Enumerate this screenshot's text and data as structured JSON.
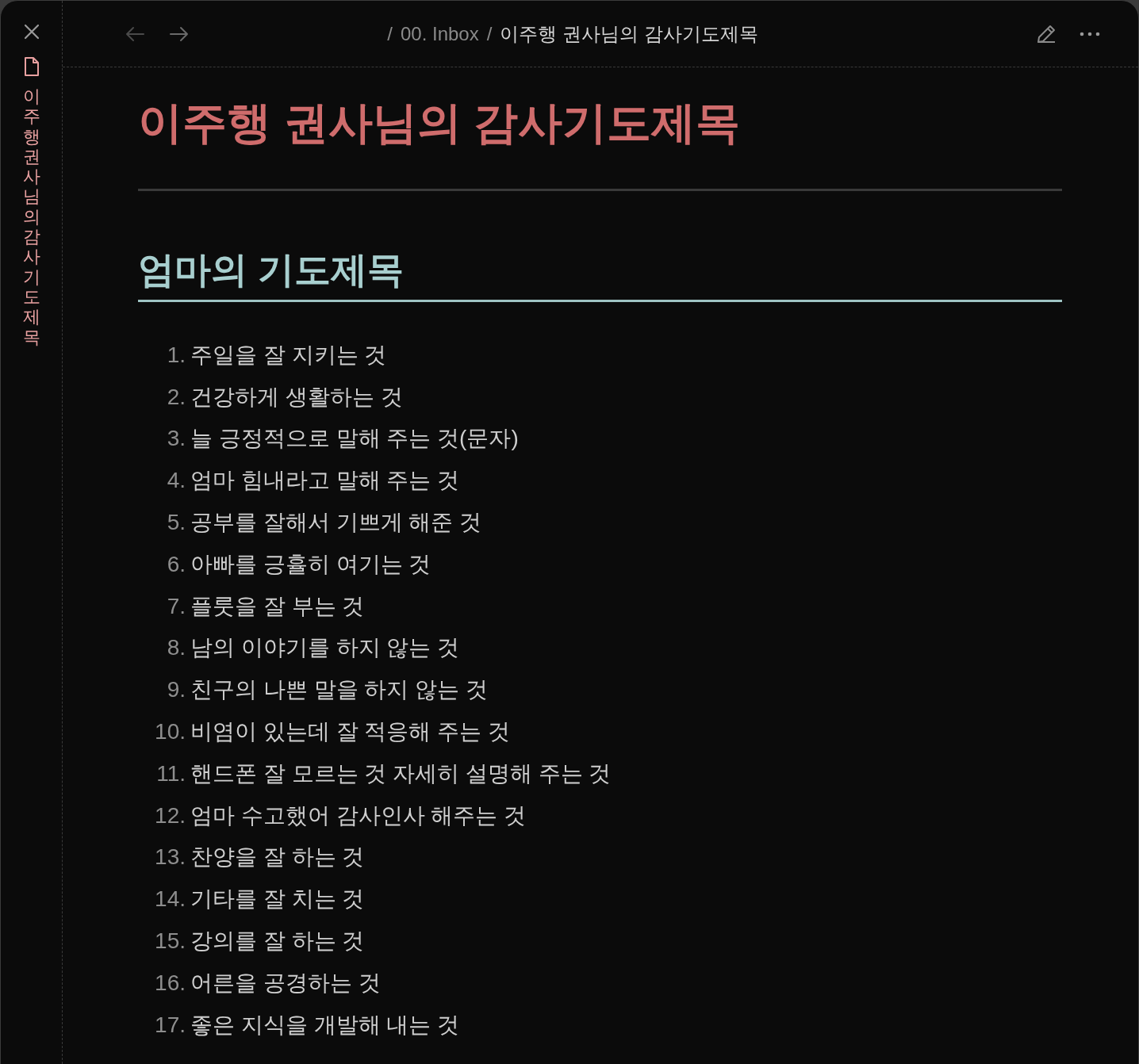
{
  "sidebar": {
    "vertical_title": "이주행 권사님의 감사기도제목"
  },
  "breadcrumb": {
    "separator": "/",
    "items": [
      {
        "label": "00. Inbox",
        "current": false
      },
      {
        "label": "이주행 권사님의 감사기도제목",
        "current": true
      }
    ]
  },
  "document": {
    "title": "이주행 권사님의 감사기도제목",
    "section": {
      "heading": "엄마의 기도제목",
      "items": [
        {
          "number": "1.",
          "text": "주일을 잘 지키는 것"
        },
        {
          "number": "2.",
          "text": "건강하게 생활하는 것"
        },
        {
          "number": "3.",
          "text": "늘 긍정적으로 말해 주는 것(문자)"
        },
        {
          "number": "4.",
          "text": "엄마 힘내라고 말해 주는 것"
        },
        {
          "number": "5.",
          "text": "공부를 잘해서 기쁘게 해준 것"
        },
        {
          "number": "6.",
          "text": "아빠를 긍휼히 여기는 것"
        },
        {
          "number": "7.",
          "text": "플룻을 잘 부는 것"
        },
        {
          "number": "8.",
          "text": "남의 이야기를 하지 않는 것"
        },
        {
          "number": "9.",
          "text": "친구의 나쁜 말을 하지 않는 것"
        },
        {
          "number": "10.",
          "text": "비염이 있는데 잘 적응해 주는 것"
        },
        {
          "number": "11.",
          "text": "핸드폰 잘 모르는 것 자세히 설명해 주는 것"
        },
        {
          "number": "12.",
          "text": "엄마 수고했어 감사인사 해주는 것"
        },
        {
          "number": "13.",
          "text": "찬양을 잘 하는 것"
        },
        {
          "number": "14.",
          "text": "기타를 잘 치는 것"
        },
        {
          "number": "15.",
          "text": "강의를 잘 하는 것"
        },
        {
          "number": "16.",
          "text": "어른을 공경하는 것"
        },
        {
          "number": "17.",
          "text": "좋은 지식을 개발해 내는 것"
        }
      ]
    }
  }
}
